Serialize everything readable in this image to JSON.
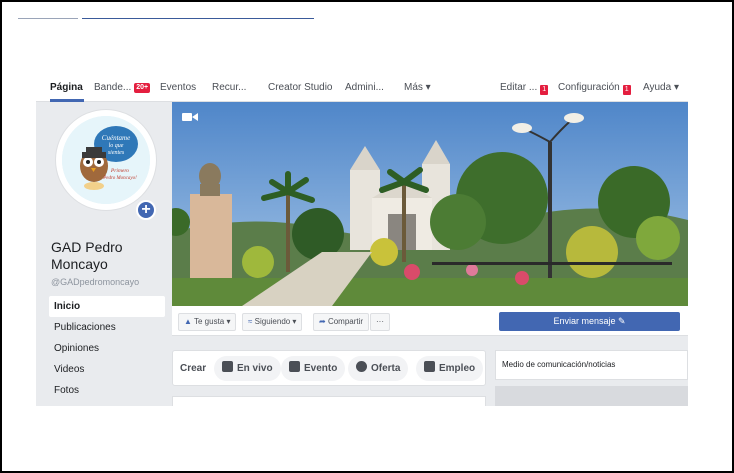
{
  "nav": {
    "items": [
      {
        "label": "Página",
        "active": true
      },
      {
        "label": "Bande...",
        "badge": "20+"
      },
      {
        "label": "Eventos"
      },
      {
        "label": "Recur..."
      },
      {
        "label": "Creator Studio"
      },
      {
        "label": "Admini..."
      },
      {
        "label": "Más ▾"
      },
      {
        "label": "Editar ...",
        "badge": "1"
      },
      {
        "label": "Configuración",
        "badge": "1"
      },
      {
        "label": "Ayuda ▾"
      }
    ]
  },
  "page": {
    "name": "GAD Pedro Moncayo",
    "handle": "@GADpedromoncayo"
  },
  "sidebar": {
    "items": [
      {
        "label": "Inicio",
        "selected": true
      },
      {
        "label": "Publicaciones"
      },
      {
        "label": "Opiniones"
      },
      {
        "label": "Videos"
      },
      {
        "label": "Fotos"
      }
    ]
  },
  "profile_text": {
    "line1": "Cuéntame",
    "line2": "lo que",
    "line3": "sientes",
    "line4": "Primero",
    "line5": "Pedro Moncayo!"
  },
  "actions": {
    "like": "Te gusta ▾",
    "following": "Siguiendo ▾",
    "share": "Compartir",
    "more": "···",
    "send_message": "Enviar mensaje ✎"
  },
  "create": {
    "label": "Crear",
    "buttons": [
      {
        "label": "En vivo",
        "icon": "live-video-icon"
      },
      {
        "label": "Evento",
        "icon": "calendar-icon"
      },
      {
        "label": "Oferta",
        "icon": "tag-icon"
      },
      {
        "label": "Empleo",
        "icon": "briefcase-icon"
      }
    ]
  },
  "about": {
    "category": "Medio de comunicación/noticias"
  },
  "colors": {
    "brand": "#4267b2",
    "badge": "#e41e3f",
    "background": "#e9ebee"
  }
}
